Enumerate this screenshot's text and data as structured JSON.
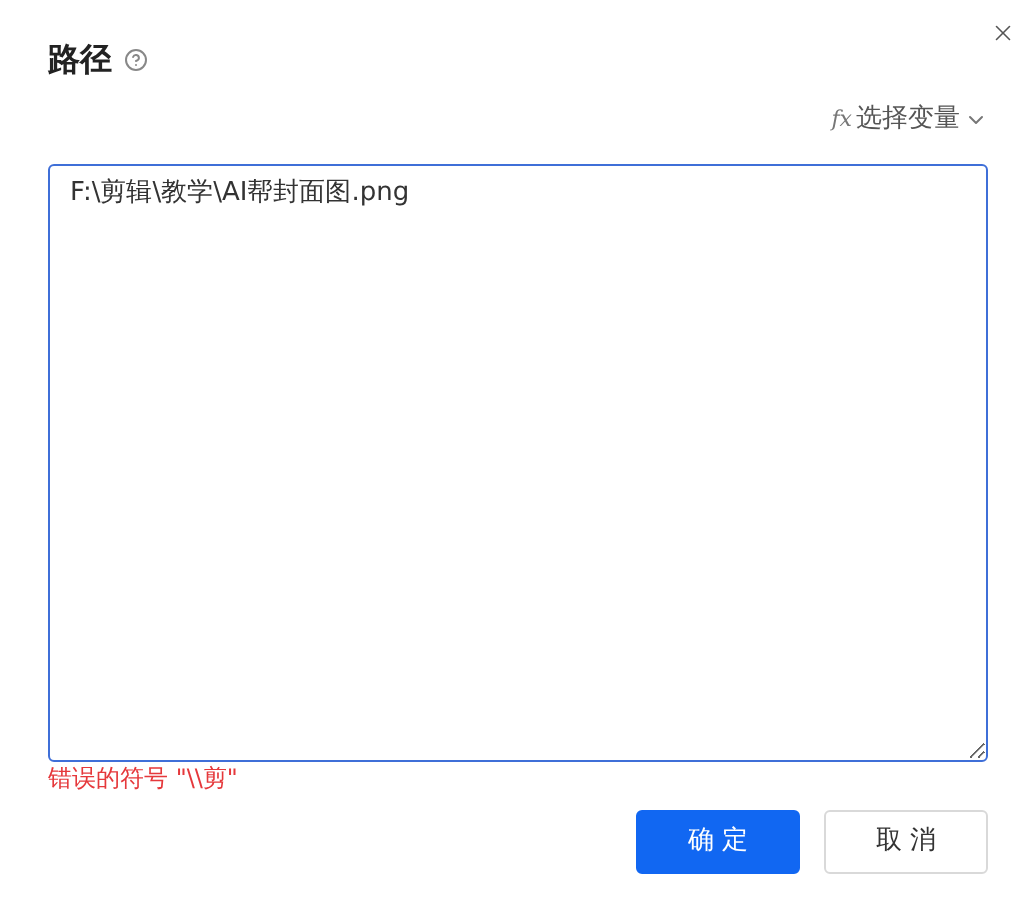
{
  "dialog": {
    "title": "路径",
    "variable_picker": {
      "prefix": "fx",
      "label": "选择变量"
    },
    "path_field": {
      "value": "F:\\剪辑\\教学\\AI帮封面图.png",
      "invalid": true
    },
    "error": "错误的符号 \"\\\\剪\"",
    "buttons": [
      {
        "label": "确 定",
        "kind": "primary"
      },
      {
        "label": "取 消",
        "kind": "secondary"
      }
    ]
  }
}
